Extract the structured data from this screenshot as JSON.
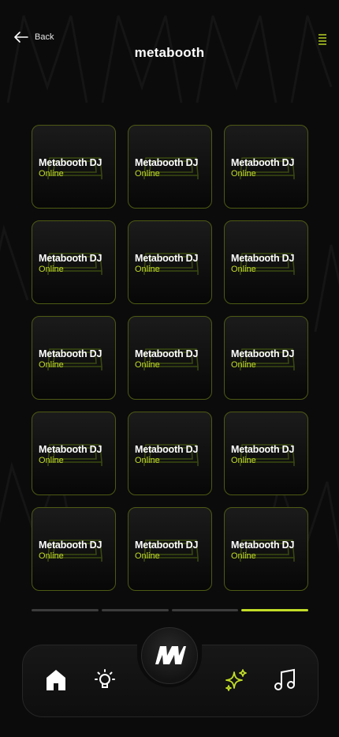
{
  "header": {
    "back_label": "Back",
    "logo_text": "metabooth"
  },
  "grid": {
    "cards": [
      {
        "title": "Metabooth DJ",
        "status": "Online"
      },
      {
        "title": "Metabooth DJ",
        "status": "Online"
      },
      {
        "title": "Metabooth DJ",
        "status": "Online"
      },
      {
        "title": "Metabooth DJ",
        "status": "Online"
      },
      {
        "title": "Metabooth DJ",
        "status": "Online"
      },
      {
        "title": "Metabooth DJ",
        "status": "Online"
      },
      {
        "title": "Metabooth DJ",
        "status": "Online"
      },
      {
        "title": "Metabooth DJ",
        "status": "Online"
      },
      {
        "title": "Metabooth DJ",
        "status": "Online"
      },
      {
        "title": "Metabooth DJ",
        "status": "Online"
      },
      {
        "title": "Metabooth DJ",
        "status": "Online"
      },
      {
        "title": "Metabooth DJ",
        "status": "Online"
      },
      {
        "title": "Metabooth DJ",
        "status": "Online"
      },
      {
        "title": "Metabooth DJ",
        "status": "Online"
      },
      {
        "title": "Metabooth DJ",
        "status": "Online"
      }
    ]
  },
  "pager": {
    "pages": 4,
    "active_index": 3
  },
  "tabbar": {
    "tabs": [
      {
        "icon": "home-icon",
        "active": false
      },
      {
        "icon": "lightbulb-icon",
        "active": false
      },
      {
        "icon": "sparkles-icon",
        "active": true
      },
      {
        "icon": "music-note-icon",
        "active": false
      }
    ],
    "center_icon": "metabooth-logo-icon"
  },
  "colors": {
    "accent": "#c2dd27",
    "background": "#0b0b0b",
    "card_border": "#4d5a14",
    "inactive_icon": "#ffffff"
  }
}
